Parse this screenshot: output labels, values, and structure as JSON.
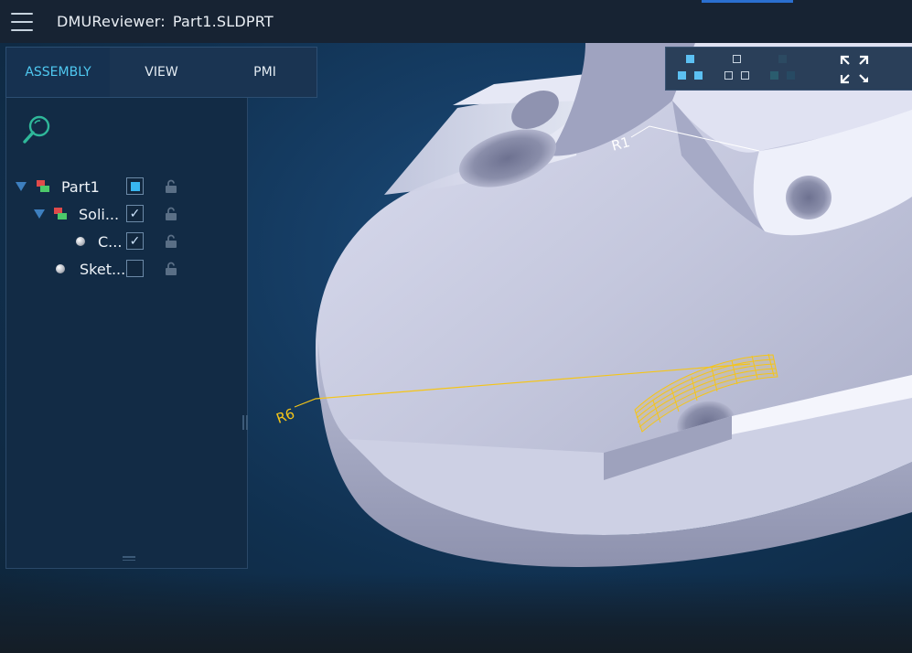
{
  "header": {
    "app_name": "DMUReviewer:",
    "file_name": "Part1.SLDPRT"
  },
  "tabs": [
    {
      "label": "ASSEMBLY",
      "active": true
    },
    {
      "label": "VIEW",
      "active": false
    },
    {
      "label": "PMI",
      "active": false
    }
  ],
  "tree": {
    "items": [
      {
        "label": "Part1",
        "level": 0,
        "icon": "part-icon",
        "check": "partial"
      },
      {
        "label": "Soli...",
        "level": 1,
        "icon": "part-icon",
        "check": "checked"
      },
      {
        "label": "C...",
        "level": 2,
        "icon": "sphere-icon",
        "check": "checked"
      },
      {
        "label": "Sket...",
        "level": 1,
        "icon": "sphere-icon",
        "check": "unchecked"
      }
    ]
  },
  "annotations": {
    "r1": "R1",
    "r6": "R6"
  },
  "colors": {
    "accent": "#4fc8f0",
    "checkbox_fill": "#38b6f0",
    "pmi_highlight": "#f5c518",
    "pmi_dimension": "#ffffff",
    "model_surface": "#c8cbe0"
  }
}
